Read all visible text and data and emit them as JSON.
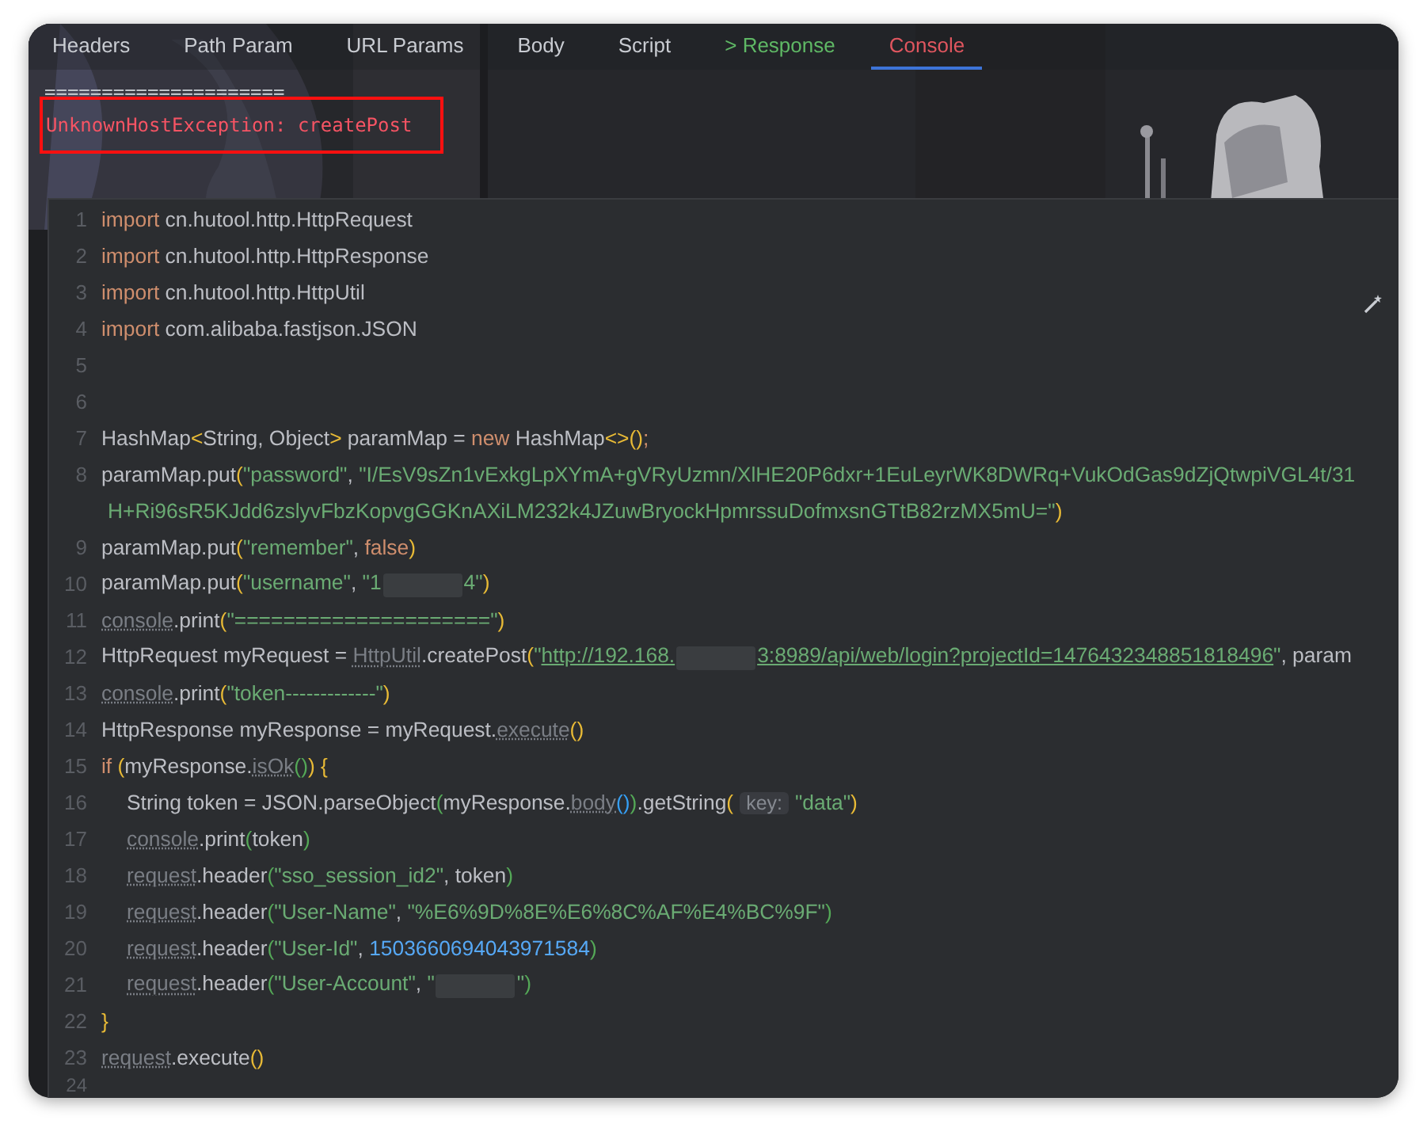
{
  "tabs": [
    {
      "label": "Headers",
      "selected": false,
      "kind": "plain"
    },
    {
      "label": "Path Param",
      "selected": false,
      "kind": "plain"
    },
    {
      "label": "URL Params",
      "selected": false,
      "kind": "plain"
    },
    {
      "label": "Body",
      "selected": false,
      "kind": "plain"
    },
    {
      "label": "Script",
      "selected": false,
      "kind": "plain"
    },
    {
      "label": "> Response",
      "selected": false,
      "kind": "result"
    },
    {
      "label": "Console",
      "selected": true,
      "kind": "plain"
    }
  ],
  "console": {
    "separator": "=====================",
    "error": "UnknownHostException: createPost"
  },
  "editor": {
    "lines": [
      {
        "number": "1",
        "segments": [
          {
            "kind": "kw",
            "text": "import"
          },
          {
            "kind": "plain",
            "text": " cn.hutool.http.HttpRequest"
          }
        ]
      },
      {
        "number": "2",
        "segments": [
          {
            "kind": "kw",
            "text": "import"
          },
          {
            "kind": "plain",
            "text": " cn.hutool.http.HttpResponse"
          }
        ]
      },
      {
        "number": "3",
        "segments": [
          {
            "kind": "kw",
            "text": "import"
          },
          {
            "kind": "plain",
            "text": " cn.hutool.http.HttpUtil"
          }
        ]
      },
      {
        "number": "4",
        "segments": [
          {
            "kind": "kw",
            "text": "import"
          },
          {
            "kind": "plain",
            "text": " com.alibaba.fastjson.JSON"
          }
        ]
      },
      {
        "number": "5"
      },
      {
        "number": "6"
      },
      {
        "number": "7",
        "segments": [
          {
            "kind": "plain",
            "text": "HashMap"
          },
          {
            "kind": "brace",
            "text": "<"
          },
          {
            "kind": "plain",
            "text": "String, Object"
          },
          {
            "kind": "brace",
            "text": ">"
          },
          {
            "kind": "plain",
            "text": " paramMap = "
          },
          {
            "kind": "kw",
            "text": "new"
          },
          {
            "kind": "plain",
            "text": " HashMap"
          },
          {
            "kind": "brace",
            "text": "<>()"
          },
          {
            "kind": "kw",
            "text": ";"
          }
        ]
      },
      {
        "number": "8",
        "segments": [
          {
            "kind": "plain",
            "text": "paramMap.put"
          },
          {
            "kind": "brace",
            "text": "("
          },
          {
            "kind": "str",
            "text": "\"password\""
          },
          {
            "kind": "plain",
            "text": ", "
          },
          {
            "kind": "str",
            "text": "\"I/EsV9sZn1vExkgLpXYmA+gVRyUzmn/XlHE20P6dxr+1EuLeyrWK8DWRq+VukOdGas9dZjQtwpiVGL4t/31"
          }
        ]
      },
      {
        "segments": [
          {
            "kind": "str",
            "text": " H+Ri96sR5KJdd6zslyvFbzKopvgGGKnAXiLM232k4JZuwBryockHpmrssuDofmxsnGTtB82rzMX5mU=\""
          },
          {
            "kind": "brace",
            "text": ")"
          }
        ]
      },
      {
        "number": "9",
        "segments": [
          {
            "kind": "plain",
            "text": "paramMap.put"
          },
          {
            "kind": "brace",
            "text": "("
          },
          {
            "kind": "str",
            "text": "\"remember\""
          },
          {
            "kind": "plain",
            "text": ", "
          },
          {
            "kind": "kw",
            "text": "false"
          },
          {
            "kind": "brace",
            "text": ")"
          }
        ]
      },
      {
        "number": "10",
        "segments": [
          {
            "kind": "plain",
            "text": "paramMap.put"
          },
          {
            "kind": "brace",
            "text": "("
          },
          {
            "kind": "str",
            "text": "\"username\""
          },
          {
            "kind": "plain",
            "text": ", "
          },
          {
            "kind": "str",
            "text": "\"1"
          },
          {
            "kind": "redacted"
          },
          {
            "kind": "str",
            "text": "4\""
          },
          {
            "kind": "brace",
            "text": ")"
          }
        ]
      },
      {
        "number": "11",
        "segments": [
          {
            "kind": "dim",
            "text": "console"
          },
          {
            "kind": "plain",
            "text": ".print"
          },
          {
            "kind": "brace",
            "text": "("
          },
          {
            "kind": "str",
            "text": "\"=====================\""
          },
          {
            "kind": "brace",
            "text": ")"
          }
        ]
      },
      {
        "number": "12",
        "segments": [
          {
            "kind": "plain",
            "text": "HttpRequest myRequest = "
          },
          {
            "kind": "dim",
            "text": "HttpUtil"
          },
          {
            "kind": "plain",
            "text": ".createPost"
          },
          {
            "kind": "brace",
            "text": "("
          },
          {
            "kind": "str",
            "text": "\""
          },
          {
            "kind": "link",
            "text": "http://192.168."
          },
          {
            "kind": "redacted"
          },
          {
            "kind": "link",
            "text": "3:8989/api/web/login?projectId=1476432348851818496"
          },
          {
            "kind": "str",
            "text": "\""
          },
          {
            "kind": "plain",
            "text": ", param"
          }
        ]
      },
      {
        "number": "13",
        "segments": [
          {
            "kind": "dim",
            "text": "console"
          },
          {
            "kind": "plain",
            "text": ".print"
          },
          {
            "kind": "brace",
            "text": "("
          },
          {
            "kind": "str",
            "text": "\"token-------------\""
          },
          {
            "kind": "brace",
            "text": ")"
          }
        ]
      },
      {
        "number": "14",
        "segments": [
          {
            "kind": "plain",
            "text": "HttpResponse myResponse = myRequest."
          },
          {
            "kind": "dim",
            "text": "execute"
          },
          {
            "kind": "brace",
            "text": "()"
          }
        ]
      },
      {
        "number": "15",
        "segments": [
          {
            "kind": "kw",
            "text": "if"
          },
          {
            "kind": "brace",
            "text": " ("
          },
          {
            "kind": "plain",
            "text": "myResponse."
          },
          {
            "kind": "dim",
            "text": "isOk"
          },
          {
            "kind": "paren2",
            "text": "()"
          },
          {
            "kind": "brace",
            "text": ") {"
          }
        ]
      },
      {
        "number": "16",
        "indent": true,
        "segments": [
          {
            "kind": "plain",
            "text": "String token = JSON.parseObject"
          },
          {
            "kind": "paren2",
            "text": "("
          },
          {
            "kind": "plain",
            "text": "myResponse."
          },
          {
            "kind": "dim",
            "text": "body"
          },
          {
            "kind": "paren3",
            "text": "()"
          },
          {
            "kind": "paren2",
            "text": ")"
          },
          {
            "kind": "plain",
            "text": ".getString"
          },
          {
            "kind": "brace",
            "text": "("
          },
          {
            "kind": "hint",
            "text": "key:"
          },
          {
            "kind": "str",
            "text": "\"data\""
          },
          {
            "kind": "brace",
            "text": ")"
          }
        ]
      },
      {
        "number": "17",
        "indent": true,
        "segments": [
          {
            "kind": "dim",
            "text": "console"
          },
          {
            "kind": "plain",
            "text": ".print"
          },
          {
            "kind": "paren2",
            "text": "("
          },
          {
            "kind": "plain",
            "text": "token"
          },
          {
            "kind": "paren2",
            "text": ")"
          }
        ]
      },
      {
        "number": "18",
        "indent": true,
        "segments": [
          {
            "kind": "dim",
            "text": "request"
          },
          {
            "kind": "plain",
            "text": ".header"
          },
          {
            "kind": "paren2",
            "text": "("
          },
          {
            "kind": "str",
            "text": "\"sso_session_id2\""
          },
          {
            "kind": "plain",
            "text": ", token"
          },
          {
            "kind": "paren2",
            "text": ")"
          }
        ]
      },
      {
        "number": "19",
        "indent": true,
        "segments": [
          {
            "kind": "dim",
            "text": "request"
          },
          {
            "kind": "plain",
            "text": ".header"
          },
          {
            "kind": "paren2",
            "text": "("
          },
          {
            "kind": "str",
            "text": "\"User-Name\""
          },
          {
            "kind": "plain",
            "text": ", "
          },
          {
            "kind": "str",
            "text": "\"%E6%9D%8E%E6%8C%AF%E4%BC%9F\""
          },
          {
            "kind": "paren2",
            "text": ")"
          }
        ]
      },
      {
        "number": "20",
        "indent": true,
        "segments": [
          {
            "kind": "dim",
            "text": "request"
          },
          {
            "kind": "plain",
            "text": ".header"
          },
          {
            "kind": "paren2",
            "text": "("
          },
          {
            "kind": "str",
            "text": "\"User-Id\""
          },
          {
            "kind": "plain",
            "text": ", "
          },
          {
            "kind": "num",
            "text": "1503660694043971584"
          },
          {
            "kind": "paren2",
            "text": ")"
          }
        ]
      },
      {
        "number": "21",
        "indent": true,
        "segments": [
          {
            "kind": "dim",
            "text": "request"
          },
          {
            "kind": "plain",
            "text": ".header"
          },
          {
            "kind": "paren2",
            "text": "("
          },
          {
            "kind": "str",
            "text": "\"User-Account\""
          },
          {
            "kind": "plain",
            "text": ", "
          },
          {
            "kind": "str",
            "text": "\""
          },
          {
            "kind": "redacted"
          },
          {
            "kind": "str",
            "text": "\""
          },
          {
            "kind": "paren2",
            "text": ")"
          }
        ]
      },
      {
        "number": "22",
        "segments": [
          {
            "kind": "brace",
            "text": "}"
          }
        ]
      },
      {
        "number": "23",
        "segments": [
          {
            "kind": "dim",
            "text": "request"
          },
          {
            "kind": "plain",
            "text": ".execute"
          },
          {
            "kind": "brace",
            "text": "()"
          }
        ]
      },
      {
        "number": "24"
      }
    ]
  }
}
